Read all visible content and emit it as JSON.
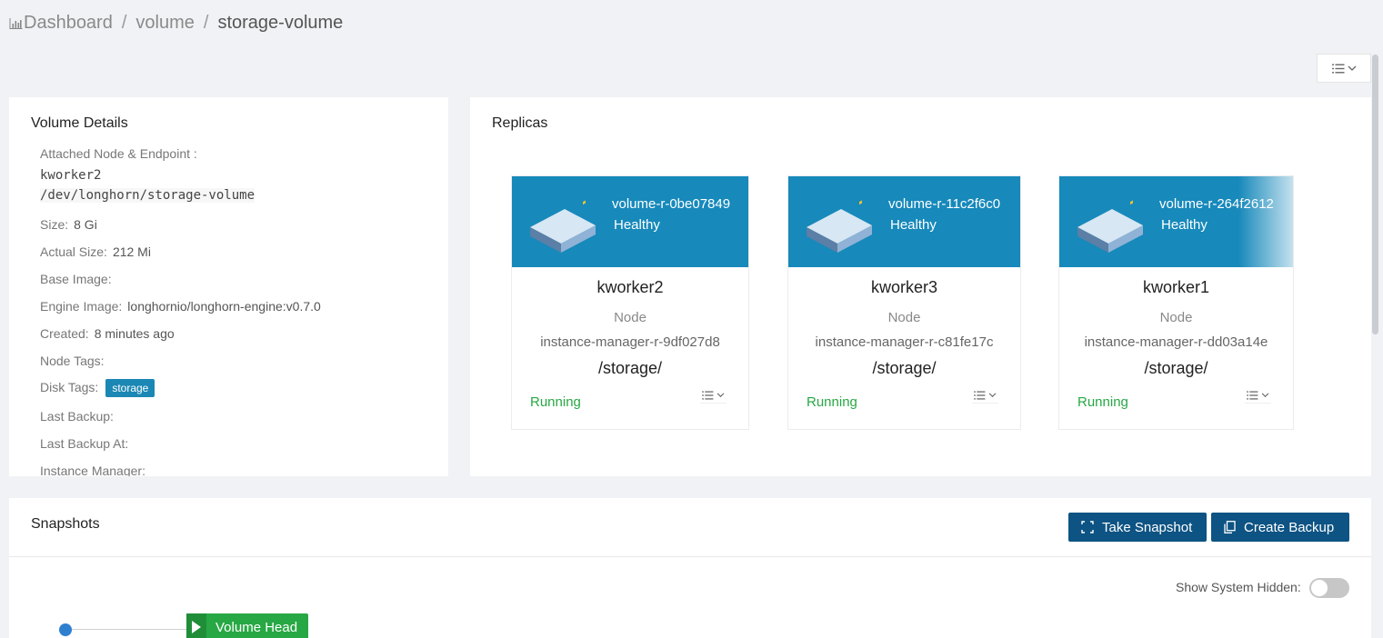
{
  "breadcrumb": {
    "items": [
      "Dashboard",
      "volume",
      "storage-volume"
    ]
  },
  "volume_details": {
    "title": "Volume Details",
    "attached_label": "Attached Node & Endpoint :",
    "attached_node": "kworker2",
    "endpoint": "/dev/longhorn/storage-volume",
    "size_label": "Size:",
    "size": "8 Gi",
    "actual_size_label": "Actual Size:",
    "actual_size": "212 Mi",
    "base_image_label": "Base Image:",
    "engine_image_label": "Engine Image:",
    "engine_image": "longhornio/longhorn-engine:v0.7.0",
    "created_label": "Created:",
    "created": "8 minutes ago",
    "node_tags_label": "Node Tags:",
    "disk_tags_label": "Disk Tags:",
    "disk_tag": "storage",
    "last_backup_label": "Last Backup:",
    "last_backup_at_label": "Last Backup At:",
    "instance_manager_label": "Instance Manager:"
  },
  "replicas": {
    "title": "Replicas",
    "items": [
      {
        "name": "volume-r-0be07849",
        "health": "Healthy",
        "node": "kworker2",
        "node_label": "Node",
        "instance_manager": "instance-manager-r-9df027d8",
        "path": "/storage/",
        "status": "Running"
      },
      {
        "name": "volume-r-11c2f6c0",
        "health": "Healthy",
        "node": "kworker3",
        "node_label": "Node",
        "instance_manager": "instance-manager-r-c81fe17c",
        "path": "/storage/",
        "status": "Running"
      },
      {
        "name": "volume-r-264f2612",
        "health": "Healthy",
        "node": "kworker1",
        "node_label": "Node",
        "instance_manager": "instance-manager-r-dd03a14e",
        "path": "/storage/",
        "status": "Running"
      }
    ]
  },
  "snapshots": {
    "title": "Snapshots",
    "take_snapshot": "Take Snapshot",
    "create_backup": "Create Backup",
    "show_system_hidden": "Show System Hidden:",
    "show_system_hidden_on": false,
    "volume_head": "Volume Head"
  },
  "colors": {
    "replica_header": "#1789bb",
    "primary_button": "#0d5383",
    "running": "#27a844",
    "tag": "#1b87b4"
  },
  "icons": [
    "bar-chart-icon",
    "list-menu-icon",
    "chevron-down-icon",
    "server-icon",
    "snapshot-icon",
    "backup-icon",
    "play-icon"
  ]
}
